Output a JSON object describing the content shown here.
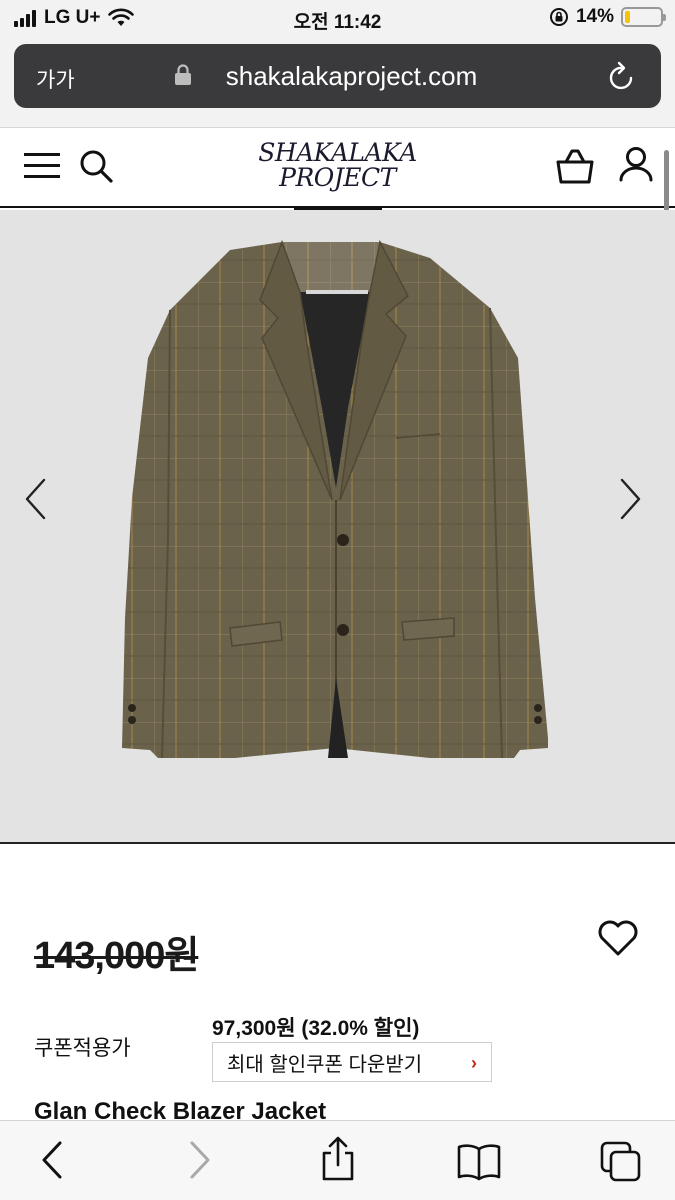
{
  "status_bar": {
    "carrier": "LG U+",
    "time": "오전 11:42",
    "battery": "14%",
    "battery_level": 0.14
  },
  "browser": {
    "text_size": "가가",
    "url": "shakalakaproject.com"
  },
  "site": {
    "logo_line1": "SHAKALAKA",
    "logo_line2": "PROJECT"
  },
  "product": {
    "original_price": "143,000원",
    "coupon_label": "쿠폰적용가",
    "sale_price": "97,300원 (32.0% 할인)",
    "coupon_button": "최대 할인쿠폰 다운받기",
    "name": "Glan Check Blazer Jacket"
  },
  "icons": {
    "menu": "hamburger-icon",
    "search": "search-icon",
    "cart": "shopping-bag-icon",
    "account": "user-icon",
    "wishlist": "heart-icon",
    "prev": "chevron-left-icon",
    "next": "chevron-right-icon"
  },
  "colors": {
    "url_bar_bg": "#3a3a3c",
    "accent_red": "#c62828",
    "battery": "#f5c400",
    "image_bg": "#e3e3e3"
  }
}
